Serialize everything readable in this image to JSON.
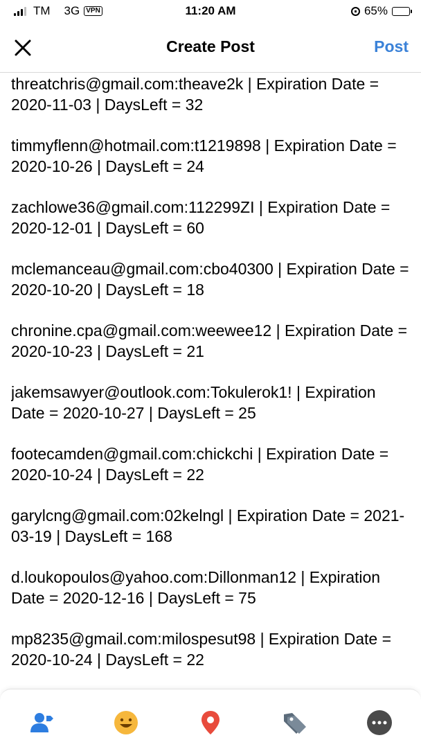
{
  "status_bar": {
    "carrier": "TM",
    "network": "3G",
    "vpn": "VPN",
    "time": "11:20 AM",
    "battery": "65%",
    "battery_level": 0.65
  },
  "header": {
    "title": "Create Post",
    "post_label": "Post"
  },
  "entries": [
    "threatchris@gmail.com:theave2k | Expiration Date = 2020-11-03 | DaysLeft = 32",
    "timmyflenn@hotmail.com:t1219898 | Expiration Date = 2020-10-26 | DaysLeft = 24",
    "zachlowe36@gmail.com:112299ZI | Expiration Date = 2020-12-01 | DaysLeft = 60",
    "mclemanceau@gmail.com:cbo40300 | Expiration Date = 2020-10-20 | DaysLeft = 18",
    "chronine.cpa@gmail.com:weewee12 | Expiration Date = 2020-10-23 | DaysLeft = 21",
    "jakemsawyer@outlook.com:Tokulerok1! | Expiration Date = 2020-10-27 | DaysLeft = 25",
    "footecamden@gmail.com:chickchi | Expiration Date = 2020-10-24 | DaysLeft = 22",
    "garylcng@gmail.com:02kelngl | Expiration Date = 2021-03-19 | DaysLeft = 168",
    "d.loukopoulos@yahoo.com:Dillonman12 | Expiration Date = 2020-12-16 | DaysLeft = 75",
    "mp8235@gmail.com:milospesut98 | Expiration Date = 2020-10-24 | DaysLeft = 22"
  ],
  "bottom_bar": {
    "icons": [
      "tag-people-icon",
      "feeling-icon",
      "location-icon",
      "tag-icon",
      "more-icon"
    ]
  },
  "colors": {
    "accent": "#3b82d8",
    "people": "#2d7de0",
    "feeling": "#f6b73c",
    "location": "#e84b3c",
    "tag": "#5b6b7a",
    "more": "#4a4a4a"
  }
}
